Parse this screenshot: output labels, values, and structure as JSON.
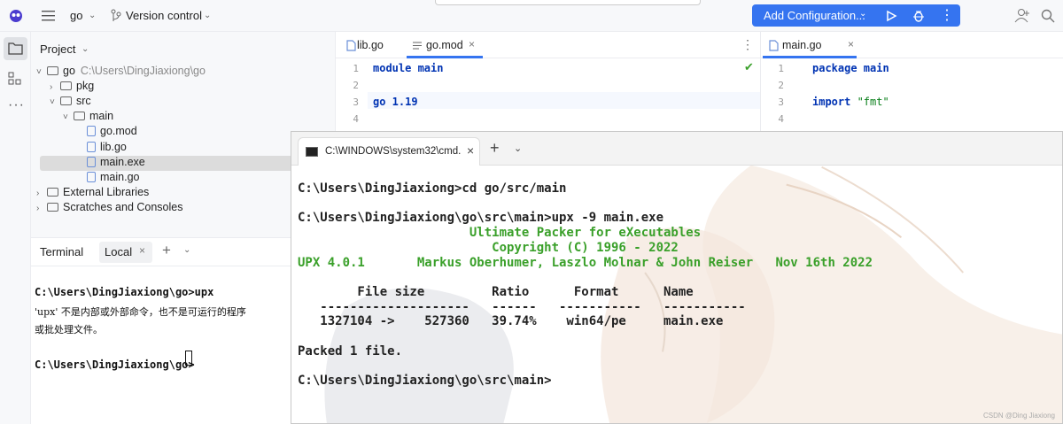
{
  "titlebar": {
    "project_name": "go",
    "vcs_label": "Version control",
    "run_config": "Add Configuration..."
  },
  "project_panel": {
    "title": "Project",
    "tree": [
      {
        "label": "go",
        "hint": "C:\\Users\\DingJiaxiong\\go",
        "type": "folder",
        "indent": 0,
        "expanded": true
      },
      {
        "label": "pkg",
        "type": "folder",
        "indent": 1,
        "expanded": false
      },
      {
        "label": "src",
        "type": "folder",
        "indent": 1,
        "expanded": true
      },
      {
        "label": "main",
        "type": "folder",
        "indent": 2,
        "expanded": true
      },
      {
        "label": "go.mod",
        "type": "file",
        "indent": 3
      },
      {
        "label": "lib.go",
        "type": "file",
        "indent": 3
      },
      {
        "label": "main.exe",
        "type": "file",
        "indent": 3,
        "selected": true
      },
      {
        "label": "main.go",
        "type": "file",
        "indent": 3
      },
      {
        "label": "External Libraries",
        "type": "lib",
        "indent": 0,
        "expanded": false
      },
      {
        "label": "Scratches and Consoles",
        "type": "lib",
        "indent": 0,
        "expanded": false
      }
    ]
  },
  "terminal_panel": {
    "title": "Terminal",
    "tab": "Local",
    "lines": [
      "C:\\Users\\DingJiaxiong\\go>upx",
      "'upx' 不是内部或外部命令，也不是可运行的程序",
      "或批处理文件。",
      "",
      "C:\\Users\\DingJiaxiong\\go>"
    ]
  },
  "editor_left": {
    "tabs": [
      "lib.go",
      "go.mod"
    ],
    "active_tab": "go.mod",
    "lines": [
      {
        "num": "1",
        "kw": "module",
        "rest": " main"
      },
      {
        "num": "2",
        "kw": "",
        "rest": ""
      },
      {
        "num": "3",
        "kw": "go",
        "rest": " 1.19"
      },
      {
        "num": "4",
        "kw": "",
        "rest": ""
      }
    ]
  },
  "editor_right": {
    "tabs": [
      "main.go"
    ],
    "lines": [
      {
        "num": "1",
        "kw": "package",
        "rest": " main"
      },
      {
        "num": "2",
        "kw": "",
        "rest": ""
      },
      {
        "num": "3",
        "kw": "import",
        "rest": " \"fmt\""
      },
      {
        "num": "4",
        "kw": "",
        "rest": ""
      }
    ]
  },
  "cmd_window": {
    "tab_title": "C:\\WINDOWS\\system32\\cmd.",
    "lines": [
      {
        "text": "C:\\Users\\DingJiaxiong>cd go/src/main",
        "green": false
      },
      {
        "text": "",
        "green": false
      },
      {
        "text": "C:\\Users\\DingJiaxiong\\go\\src\\main>upx -9 main.exe",
        "green": false
      },
      {
        "text": "                       Ultimate Packer for eXecutables",
        "green": true
      },
      {
        "text": "                          Copyright (C) 1996 - 2022",
        "green": true
      },
      {
        "text": "UPX 4.0.1       Markus Oberhumer, Laszlo Molnar & John Reiser   Nov 16th 2022",
        "green": true
      },
      {
        "text": "",
        "green": false
      },
      {
        "text": "        File size         Ratio      Format      Name",
        "green": false
      },
      {
        "text": "   --------------------   ------   -----------   -----------",
        "green": false
      },
      {
        "text": "   1327104 ->    527360   39.74%    win64/pe     main.exe",
        "green": false
      },
      {
        "text": "",
        "green": false
      },
      {
        "text": "Packed 1 file.",
        "green": false
      },
      {
        "text": "",
        "green": false
      },
      {
        "text": "C:\\Users\\DingJiaxiong\\go\\src\\main>",
        "green": false
      }
    ]
  },
  "watermark": "CSDN @Ding Jiaxiong"
}
